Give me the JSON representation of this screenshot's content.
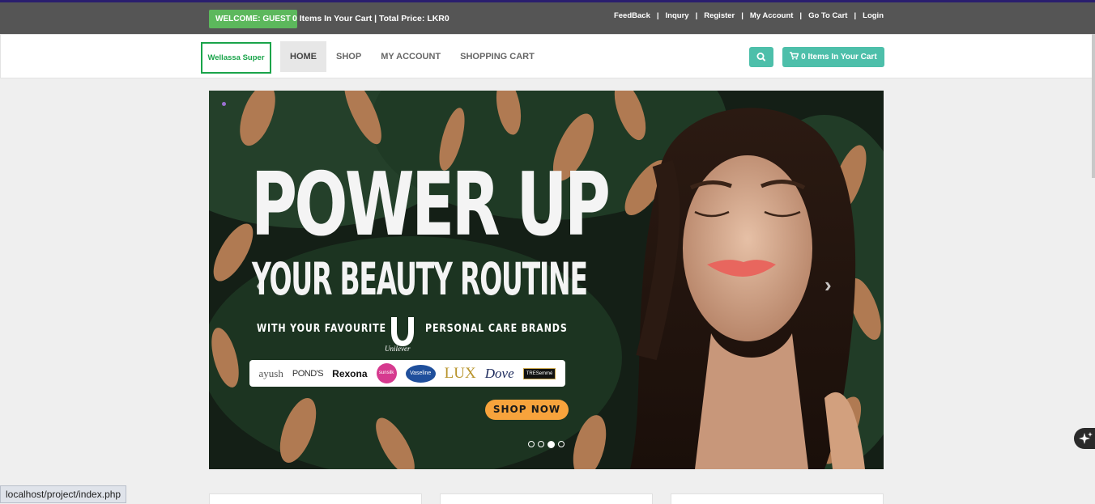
{
  "topbar": {
    "welcome": "WELCOME: GUEST",
    "cart_summary": "0 Items In Your Cart | Total Price: LKR0",
    "links": [
      "FeedBack",
      "Inqury",
      "Register",
      "My Account",
      "Go To Cart",
      "Login"
    ],
    "separator": "|"
  },
  "navbar": {
    "brand": "Wellassa Super",
    "links": [
      "HOME",
      "SHOP",
      "MY ACCOUNT",
      "SHOPPING CART"
    ],
    "active": "HOME",
    "cart_button": "0 Items In Your Cart",
    "accent_color": "#4dbfaa"
  },
  "hero": {
    "headline_1": "POWER UP",
    "headline_2": "YOUR BEAUTY ROUTINE",
    "tagline_left": "WITH YOUR FAVOURITE",
    "tagline_right": "PERSONAL CARE BRANDS",
    "unilever": "Unilever",
    "brands": [
      "ayush",
      "POND'S",
      "Rexona",
      "sunsilk",
      "Vaseline",
      "LUX",
      "Dove",
      "TRESemmé"
    ],
    "cta": "SHOP NOW",
    "slide_count": 4,
    "active_slide": 3
  },
  "status_bar": {
    "url": "localhost/project/index.php"
  }
}
